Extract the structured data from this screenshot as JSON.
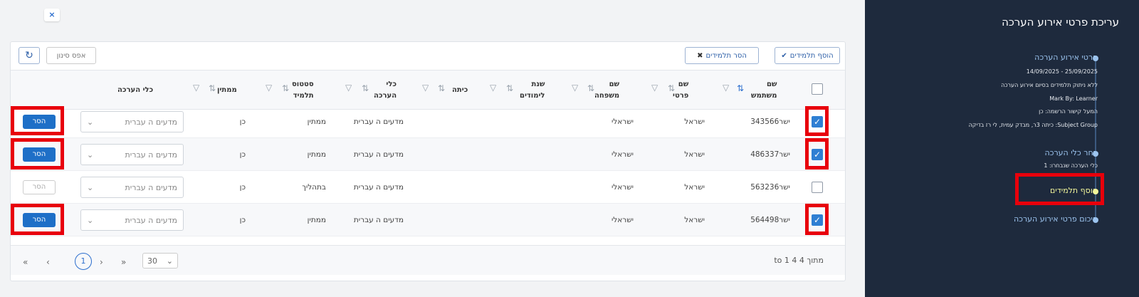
{
  "close_label": "×",
  "toolbar": {
    "add_students": "הוסף תלמידים",
    "remove_students": "הסר תלמידים",
    "reset_filter": "אפס סינון"
  },
  "columns": {
    "username": "שם\nמשתמש",
    "first_name": "שם\nפרטי",
    "last_name": "שם\nמשפחה",
    "school_year": "שנת\nלימודים",
    "class": "כיתה",
    "assessment_tools": "כלי\nהערכה",
    "student_status": "סטטוס\nתלמיד",
    "examinee": "ממתין",
    "assessment_tool": "כלי הערכה"
  },
  "rows": [
    {
      "checked": true,
      "username": "ישר343566",
      "first_name": "ישראל",
      "last_name": "ישראלי",
      "tools": "מדעים ה עברית",
      "status": "ממתין",
      "examinee": "כן",
      "select_placeholder": "מדעים ה עברית",
      "remove_label": "הסר"
    },
    {
      "checked": true,
      "username": "ישר486337",
      "first_name": "ישראל",
      "last_name": "ישראלי",
      "tools": "מדעים ה עברית",
      "status": "ממתין",
      "examinee": "כן",
      "select_placeholder": "מדעים ה עברית",
      "remove_label": "הסר"
    },
    {
      "checked": false,
      "username": "ישר563236",
      "first_name": "ישראל",
      "last_name": "ישראלי",
      "tools": "מדעים ה עברית",
      "status": "בתהליך",
      "examinee": "כן",
      "select_placeholder": "מדעים ה עברית",
      "remove_label": "הסר"
    },
    {
      "checked": true,
      "username": "ישר564498",
      "first_name": "ישראל",
      "last_name": "ישראלי",
      "tools": "מדעים ה עברית",
      "status": "ממתין",
      "examinee": "כן",
      "select_placeholder": "מדעים ה עברית",
      "remove_label": "הסר"
    }
  ],
  "pagination": {
    "first": "«",
    "prev": "‹",
    "current": "1",
    "next": "›",
    "last": "»",
    "page_size": "30",
    "info": "מתוך 4 4 to 1"
  },
  "sidebar": {
    "title": "עריכת פרטי אירוע הערכה",
    "steps": [
      {
        "title": "פרטי אירוע הערכה",
        "active": false,
        "lines": [
          "25/09/2025 - 14/09/2025",
          "ללא ניתוק תלמידים בסיום אירוע הערכה",
          "Mark By: Learner",
          "המעל קישור הרשמה: כן",
          "Subject Group: כיתה 3ר, מבדק עמית, לי רז בדיקה"
        ]
      },
      {
        "title": "בחר כלי הערכה",
        "active": false,
        "lines": [
          "כלי הערכה שנבחרו: 1"
        ]
      },
      {
        "title": "הוסף תלמידים",
        "active": true,
        "lines": []
      },
      {
        "title": "סיכום פרטי אירוע הערכה",
        "active": false,
        "lines": []
      }
    ]
  },
  "colors": {
    "accent": "#2f7fd3",
    "highlight": "#e8000b",
    "sidebar_bg": "#1e2a3d",
    "active_step": "#f1f59a"
  }
}
